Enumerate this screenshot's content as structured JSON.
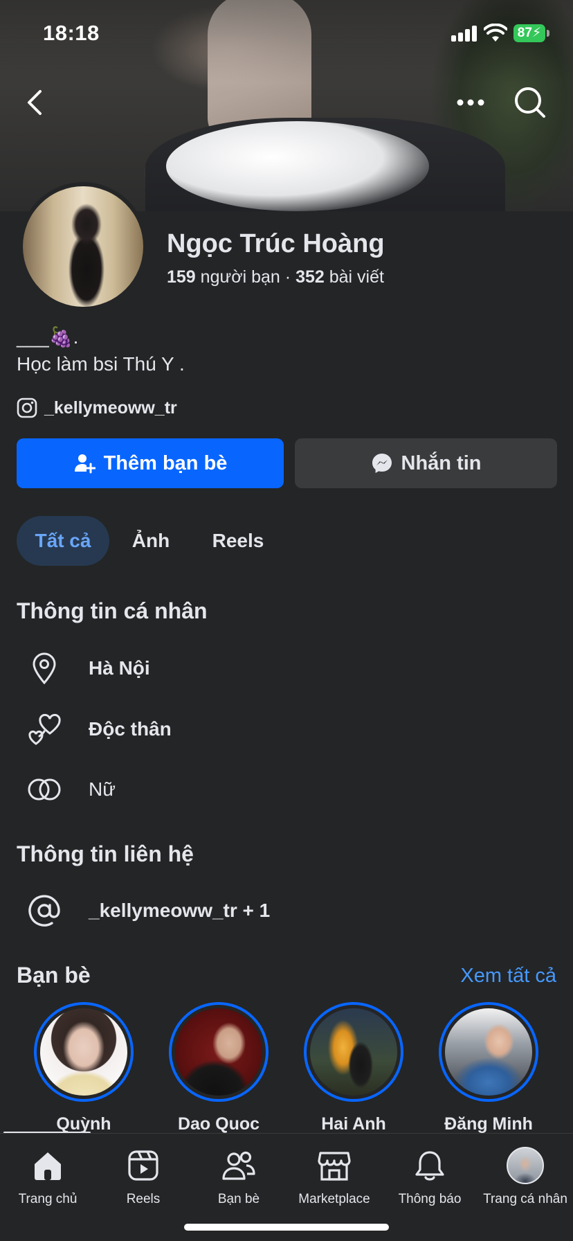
{
  "status_bar": {
    "time": "18:18",
    "battery": "87"
  },
  "top_actions": {
    "back": "back-icon",
    "more": "more-icon",
    "search": "search-icon"
  },
  "profile": {
    "name": "Ngọc Trúc Hoàng",
    "friends_count": "159",
    "friends_label": "người bạn",
    "separator": "·",
    "posts_count": "352",
    "posts_label": "bài viết",
    "bio_line1": "___🍇.",
    "bio_line2": "Học làm bsi Thú Y .",
    "instagram": "_kellymeoww_tr"
  },
  "actions": {
    "add_friend": "Thêm bạn bè",
    "message": "Nhắn tin"
  },
  "tabs": [
    {
      "label": "Tất cả",
      "active": true
    },
    {
      "label": "Ảnh",
      "active": false
    },
    {
      "label": "Reels",
      "active": false
    }
  ],
  "personal_info": {
    "title": "Thông tin cá nhân",
    "items": [
      {
        "icon": "location-pin-icon",
        "text": "Hà Nội"
      },
      {
        "icon": "relationship-hearts-icon",
        "text": "Độc thân"
      },
      {
        "icon": "gender-rings-icon",
        "text": "Nữ"
      }
    ]
  },
  "contact_info": {
    "title": "Thông tin liên hệ",
    "items": [
      {
        "icon": "at-sign-icon",
        "text": "_kellymeoww_tr + 1"
      }
    ]
  },
  "friends": {
    "title": "Bạn bè",
    "see_all": "Xem tất cả",
    "list": [
      {
        "name": "Quỳnh"
      },
      {
        "name": "Dao Quoc"
      },
      {
        "name": "Hai Anh"
      },
      {
        "name": "Đăng Minh"
      }
    ]
  },
  "bottom_nav": [
    {
      "label": "Trang chủ",
      "icon": "home-icon",
      "active": true
    },
    {
      "label": "Reels",
      "icon": "reels-icon",
      "active": false
    },
    {
      "label": "Bạn bè",
      "icon": "friends-icon",
      "active": false
    },
    {
      "label": "Marketplace",
      "icon": "marketplace-icon",
      "active": false
    },
    {
      "label": "Thông báo",
      "icon": "bell-icon",
      "active": false
    },
    {
      "label": "Trang cá nhân",
      "icon": "profile-avatar-icon",
      "active": false
    }
  ],
  "colors": {
    "accent": "#0866ff",
    "link": "#4599ff",
    "background": "#242526",
    "button_secondary": "#3a3b3c",
    "tab_active_bg": "#263951"
  }
}
